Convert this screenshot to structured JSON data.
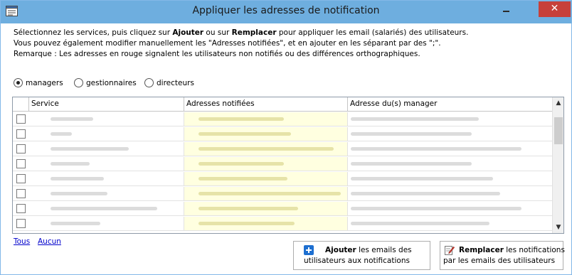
{
  "window": {
    "title": "Appliquer les adresses de notification",
    "close_glyph": "✕"
  },
  "instructions": {
    "line1_a": "Sélectionnez les services, puis cliquez sur ",
    "line1_b": "Ajouter",
    "line1_c": " ou sur ",
    "line1_d": "Remplacer",
    "line1_e": " pour appliquer les email (salariés) des utilisateurs.",
    "line2": "Vous pouvez également modifier manuellement les \"Adresses notifiées\", et en ajouter en les séparant par des \";\".",
    "line3": "Remarque : Les adresses en rouge signalent les utilisateurs non notifiés ou des différences orthographiques."
  },
  "radios": [
    {
      "label": "managers",
      "selected": true
    },
    {
      "label": "gestionnaires",
      "selected": false
    },
    {
      "label": "directeurs",
      "selected": false
    }
  ],
  "grid": {
    "columns": [
      "Service",
      "Adresses notifiées",
      "Adresse du(s) manager"
    ],
    "row_count": 8,
    "scroll_up_glyph": "▲",
    "scroll_down_glyph": "▼"
  },
  "links": {
    "all": "Tous",
    "none": "Aucun"
  },
  "buttons": {
    "add": {
      "bold": "Ajouter",
      "rest": " les emails des",
      "line2": "utilisateurs aux notifications",
      "icon": "plus-icon"
    },
    "replace": {
      "bold": "Remplacer",
      "rest": " les notifications",
      "line2": "par les emails des utilisateurs",
      "icon": "edit-icon"
    }
  },
  "colors": {
    "titlebar": "#6eaedf",
    "close": "#c7403a",
    "notif_cell": "#ffffe0",
    "link": "#0000cc"
  }
}
